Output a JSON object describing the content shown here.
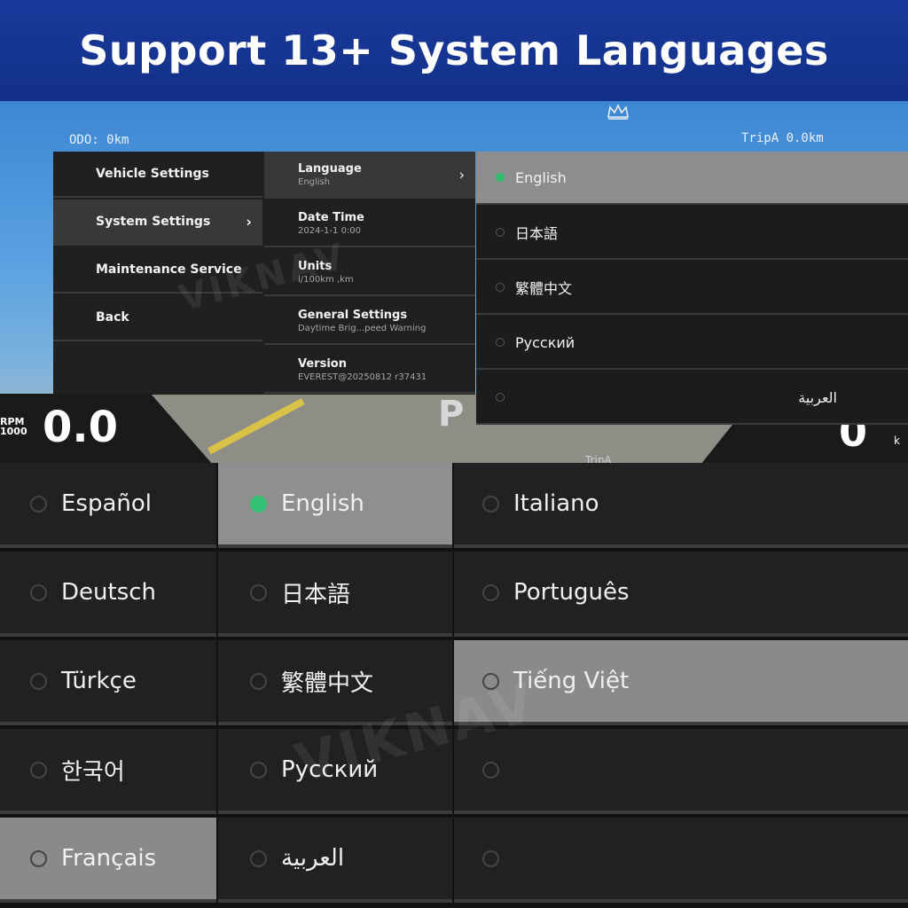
{
  "banner": {
    "title": "Support 13+ System Languages"
  },
  "hud": {
    "odo": "ODO: 0km",
    "trip_a": "TripA 0.0km",
    "rpm_label": "RPM\n1000",
    "rpm_value": "0.0",
    "speed_value": "0",
    "speed_unit": "k",
    "gear": "P",
    "trip_a_bottom": "TripA",
    "km_small": "km"
  },
  "menu": {
    "items": [
      {
        "label": "Vehicle Settings"
      },
      {
        "label": "System Settings",
        "chevron": "›"
      },
      {
        "label": "Maintenance Service"
      },
      {
        "label": "Back"
      }
    ],
    "settings": [
      {
        "title": "Language",
        "sub": "English",
        "chevron": "›"
      },
      {
        "title": "Date Time",
        "sub": "2024-1-1 0:00"
      },
      {
        "title": "Units",
        "sub": "l/100km ,km"
      },
      {
        "title": "General Settings",
        "sub": "Daytime Brig...peed Warning"
      },
      {
        "title": "Version",
        "sub": "EVEREST@20250812 r37431"
      }
    ]
  },
  "lang_panel": {
    "items": [
      "English",
      "日本語",
      "繁體中文",
      "Русский",
      "العربية"
    ]
  },
  "grid": {
    "col1": [
      "Español",
      "Deutsch",
      "Türkçe",
      "한국어",
      "Français"
    ],
    "col2": [
      "English",
      "日本語",
      "繁體中文",
      "Русский",
      "العربية"
    ],
    "col3": [
      "Italiano",
      "Português",
      "Tiếng Việt",
      "",
      ""
    ]
  },
  "watermark": "VIKNAV",
  "colors": {
    "banner": "#1a3a9c",
    "selected_radio": "#34c173",
    "selected_row": "#8f8f8f"
  }
}
